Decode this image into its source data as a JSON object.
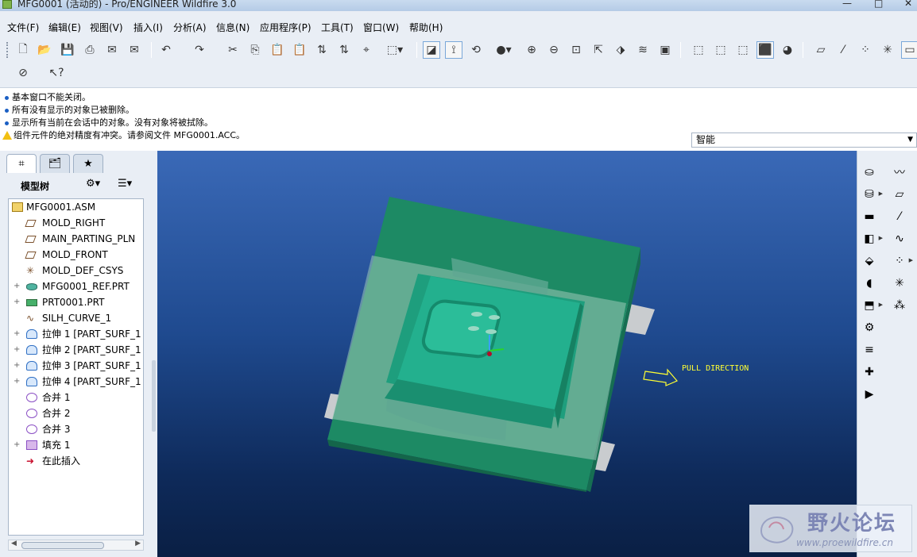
{
  "window": {
    "title": "MFG0001 (活动的) - Pro/ENGINEER Wildfire 3.0"
  },
  "menu": [
    "文件(F)",
    "编辑(E)",
    "视图(V)",
    "插入(I)",
    "分析(A)",
    "信息(N)",
    "应用程序(P)",
    "工具(T)",
    "窗口(W)",
    "帮助(H)"
  ],
  "messages": [
    {
      "type": "info",
      "text": "基本窗口不能关闭。"
    },
    {
      "type": "info",
      "text": "所有没有显示的对象已被删除。"
    },
    {
      "type": "info",
      "text": "显示所有当前在会话中的对象。没有对象将被拭除。"
    },
    {
      "type": "warning",
      "text": "组件元件的绝对精度有冲突。请参阅文件 MFG0001.ACC。"
    }
  ],
  "filter": {
    "value": "智能"
  },
  "panel": {
    "title": "模型树",
    "tabs": [
      "model-tree-tab",
      "folder-tab",
      "favorites-tab"
    ]
  },
  "tree": {
    "root": "MFG0001.ASM",
    "items": [
      {
        "label": "MOLD_RIGHT",
        "icon": "datum-plane-icon",
        "expandable": false
      },
      {
        "label": "MAIN_PARTING_PLN",
        "icon": "datum-plane-icon",
        "expandable": false
      },
      {
        "label": "MOLD_FRONT",
        "icon": "datum-plane-icon",
        "expandable": false
      },
      {
        "label": "MOLD_DEF_CSYS",
        "icon": "csys-icon",
        "expandable": false
      },
      {
        "label": "MFG0001_REF.PRT",
        "icon": "ref-part-icon",
        "expandable": true
      },
      {
        "label": "PRT0001.PRT",
        "icon": "workpiece-icon",
        "expandable": true
      },
      {
        "label": "SILH_CURVE_1",
        "icon": "curve-icon",
        "expandable": false
      },
      {
        "label": "拉伸 1 [PART_SURF_1 -",
        "icon": "extrude-surface-icon",
        "expandable": true
      },
      {
        "label": "拉伸 2 [PART_SURF_1 -",
        "icon": "extrude-surface-icon",
        "expandable": true
      },
      {
        "label": "拉伸 3 [PART_SURF_1 -",
        "icon": "extrude-surface-icon",
        "expandable": true
      },
      {
        "label": "拉伸 4 [PART_SURF_1 -",
        "icon": "extrude-surface-icon",
        "expandable": true
      },
      {
        "label": "合并 1",
        "icon": "merge-icon",
        "expandable": false
      },
      {
        "label": "合并 2",
        "icon": "merge-icon",
        "expandable": false
      },
      {
        "label": "合并 3",
        "icon": "merge-icon",
        "expandable": false
      },
      {
        "label": "填充 1",
        "icon": "fill-icon",
        "expandable": true
      },
      {
        "label": "在此插入",
        "icon": "insert-here-icon",
        "expandable": false
      }
    ]
  },
  "viewport": {
    "annotation": "PULL DIRECTION",
    "annotation_color": "#ffff33",
    "mold_color": "#1f8f6a",
    "part_color": "#23b08e"
  },
  "watermark": {
    "cn": "野火论坛",
    "url": "www.proewildfire.cn"
  }
}
